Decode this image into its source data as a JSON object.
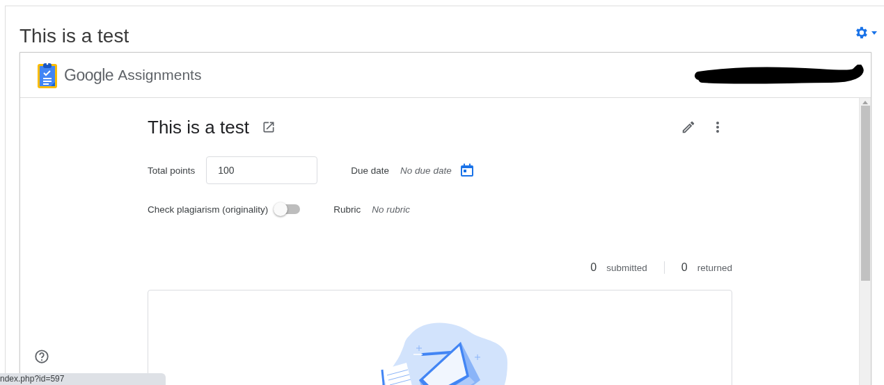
{
  "page": {
    "title": "This is a test"
  },
  "app": {
    "brand_google": "Google",
    "brand_product": "Assignments"
  },
  "assignment": {
    "title": "This is a test",
    "total_points_label": "Total points",
    "total_points": "100",
    "due_date_label": "Due date",
    "due_date": "No due date",
    "plagiarism_label": "Check plagiarism (originality)",
    "plagiarism_on": false,
    "rubric_label": "Rubric",
    "rubric": "No rubric"
  },
  "stats": [
    {
      "count": "0",
      "label": "submitted"
    },
    {
      "count": "0",
      "label": "returned"
    }
  ],
  "status_bar": "ndex.php?id=597"
}
